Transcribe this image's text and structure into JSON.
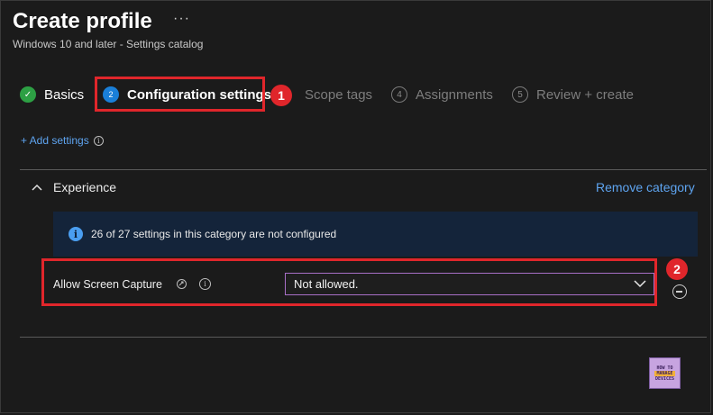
{
  "header": {
    "title": "Create profile",
    "more_label": "···",
    "subtitle": "Windows 10 and later - Settings catalog"
  },
  "steps": [
    {
      "number": "✓",
      "label": "Basics",
      "state": "done"
    },
    {
      "number": "2",
      "label": "Configuration settings",
      "state": "current"
    },
    {
      "number": "",
      "label": "Scope tags",
      "state": "todo"
    },
    {
      "number": "4",
      "label": "Assignments",
      "state": "todo"
    },
    {
      "number": "5",
      "label": "Review + create",
      "state": "todo"
    }
  ],
  "annotations": {
    "badge1": "1",
    "badge2": "2"
  },
  "add_settings": {
    "label": "+ Add settings",
    "info_icon": "i"
  },
  "category": {
    "title": "Experience",
    "remove_label": "Remove category",
    "banner_icon": "i",
    "banner_text": "26 of 27 settings in this category are not configured"
  },
  "setting": {
    "label": "Allow Screen Capture",
    "info_icon": "i",
    "value": "Not allowed."
  },
  "logo": {
    "line1": "HOW TO",
    "line2": "MANAGE",
    "line3": "DEVICES"
  },
  "colors": {
    "accent_blue": "#5ea4f0",
    "highlight_red": "#e0262b",
    "done_green": "#2da044",
    "current_blue": "#1a7fd8"
  }
}
